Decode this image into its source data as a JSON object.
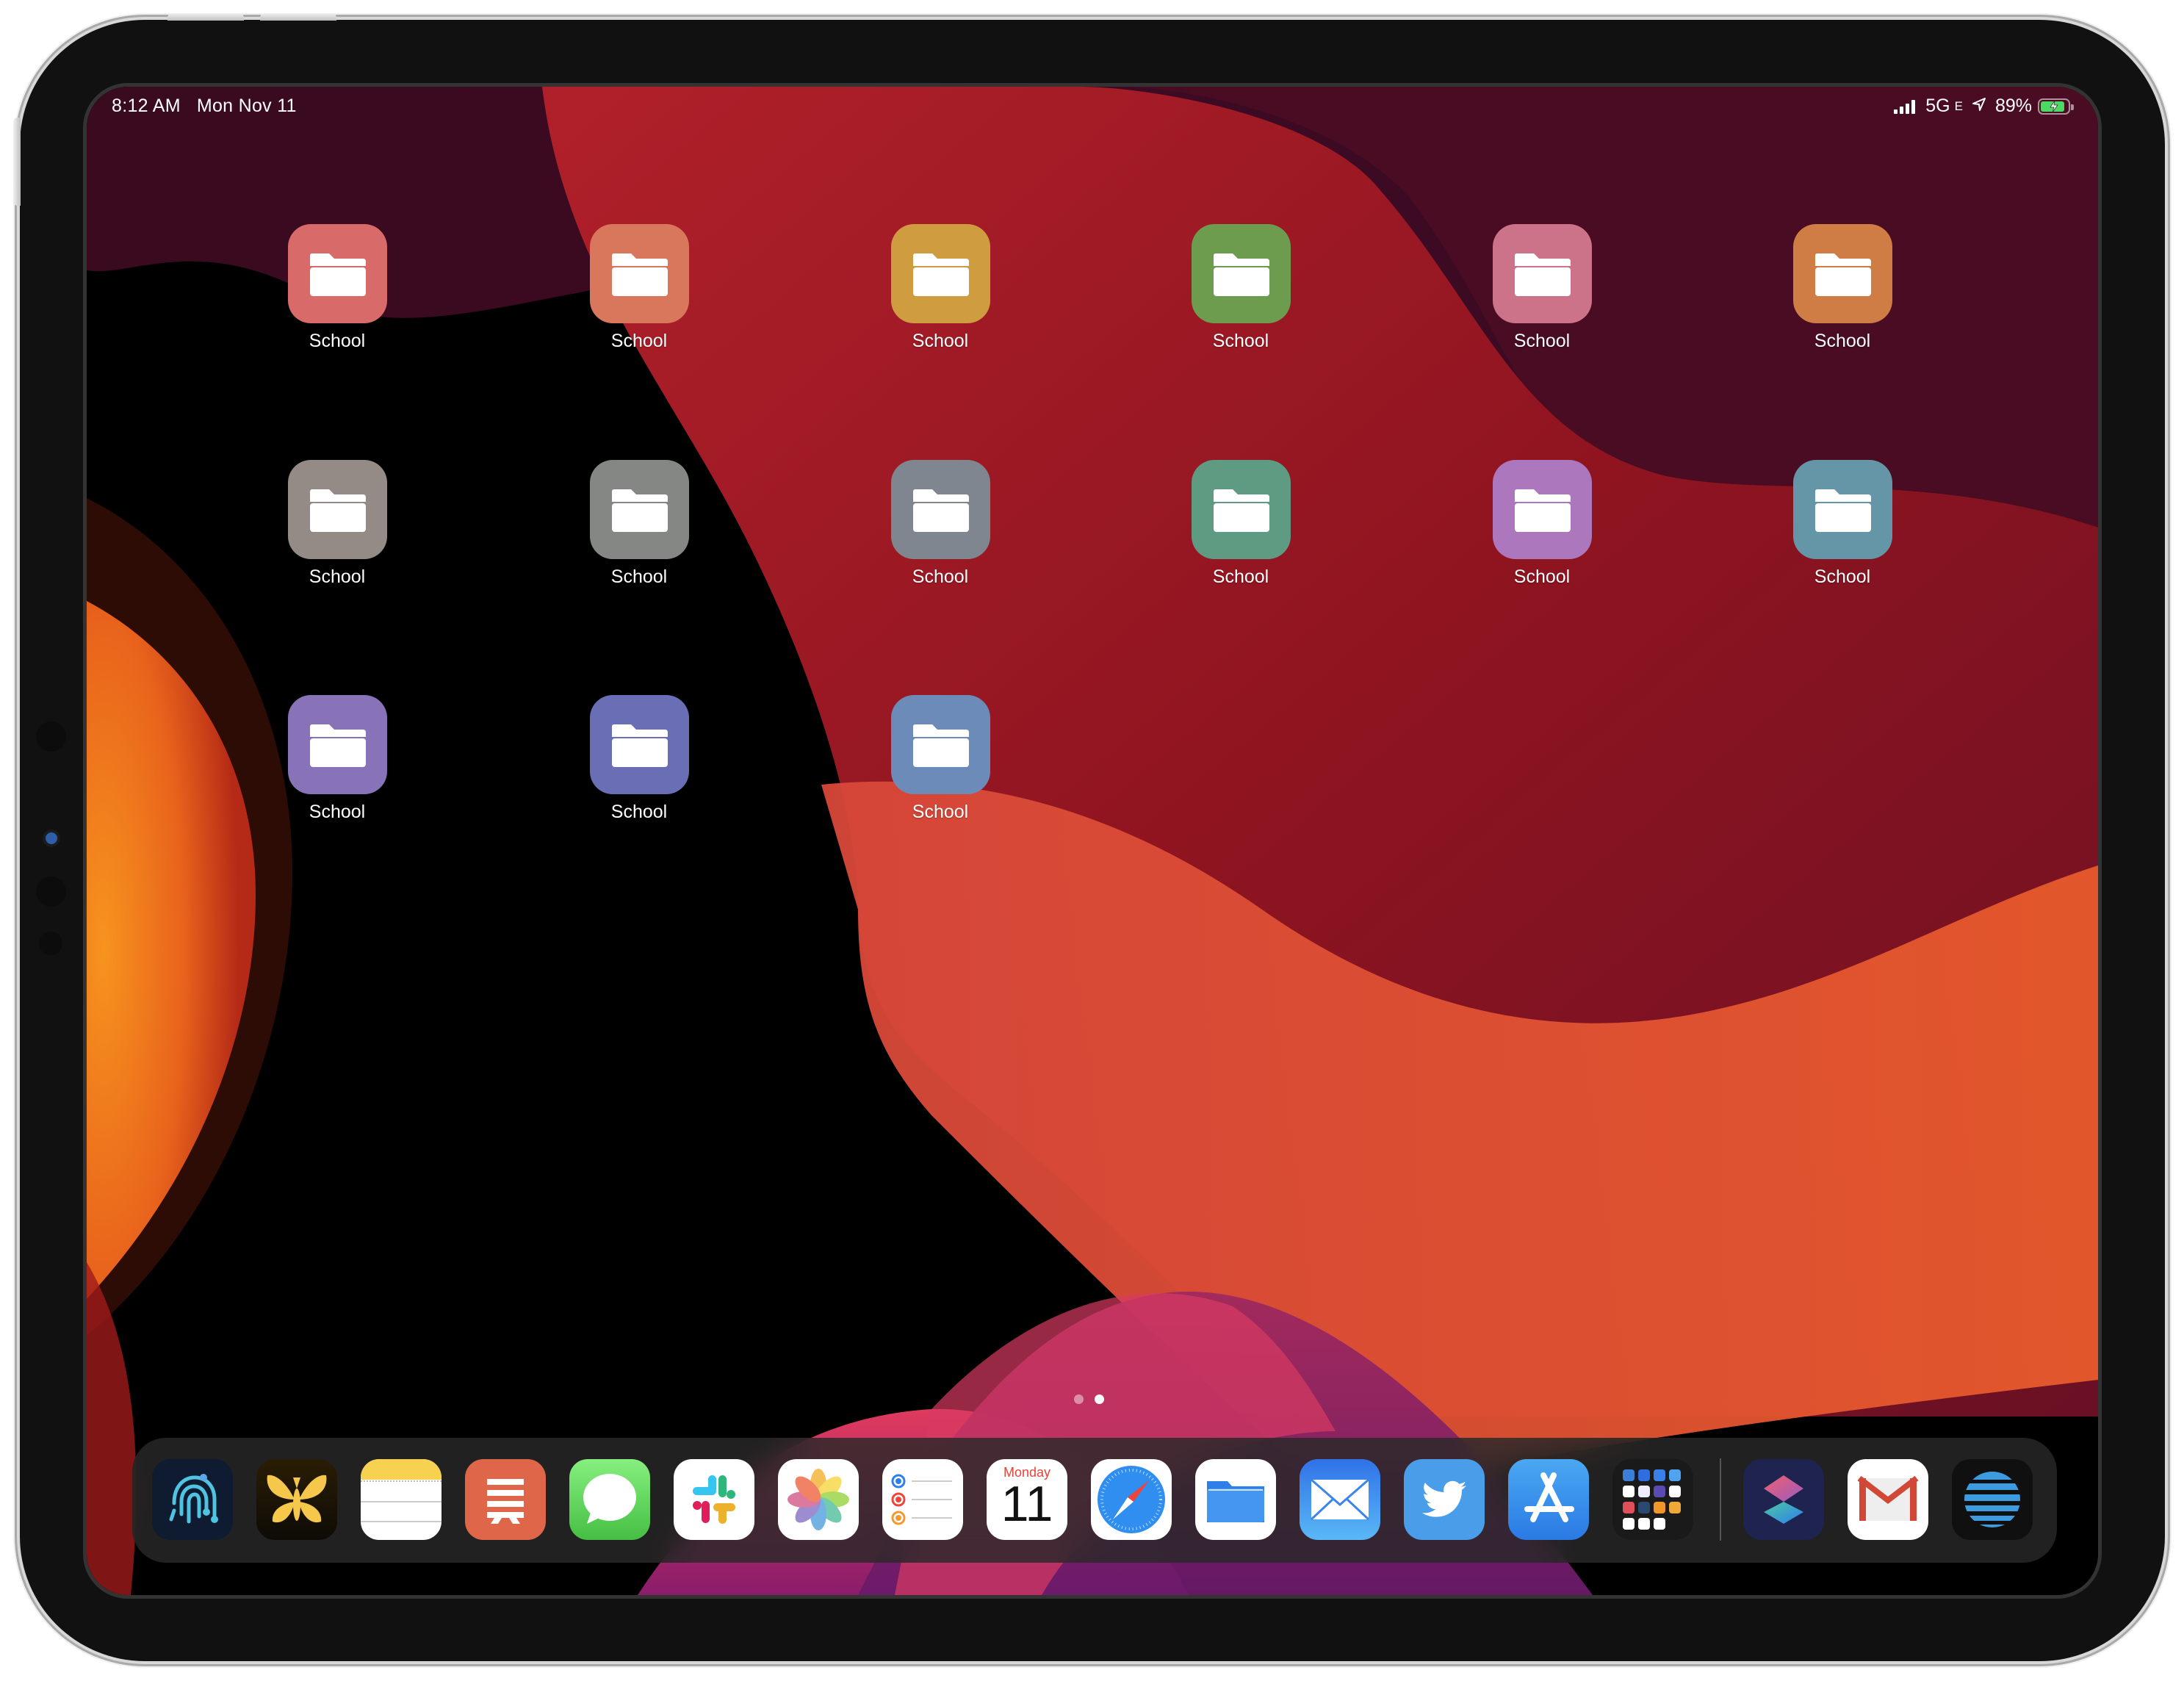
{
  "status_bar": {
    "time": "8:12 AM",
    "date": "Mon Nov 11",
    "network": "5G",
    "network_sub": "E",
    "battery_percent": "89%",
    "battery_level": 0.89,
    "charging": true,
    "icons": [
      "signal-bars-icon",
      "location-arrow-icon",
      "battery-charging-icon"
    ]
  },
  "home_screen": {
    "apps": [
      {
        "label": "School",
        "icon": "folder-icon",
        "color": "#d86a6a"
      },
      {
        "label": "School",
        "icon": "folder-icon",
        "color": "#d9775c"
      },
      {
        "label": "School",
        "icon": "folder-icon",
        "color": "#cf9c40"
      },
      {
        "label": "School",
        "icon": "folder-icon",
        "color": "#6e9c4f"
      },
      {
        "label": "School",
        "icon": "folder-icon",
        "color": "#cd7389"
      },
      {
        "label": "School",
        "icon": "folder-icon",
        "color": "#d07d45"
      },
      {
        "label": "School",
        "icon": "folder-icon",
        "color": "#948a86"
      },
      {
        "label": "School",
        "icon": "folder-icon",
        "color": "#848784"
      },
      {
        "label": "School",
        "icon": "folder-icon",
        "color": "#7f8690"
      },
      {
        "label": "School",
        "icon": "folder-icon",
        "color": "#5f9a82"
      },
      {
        "label": "School",
        "icon": "folder-icon",
        "color": "#ad77bd"
      },
      {
        "label": "School",
        "icon": "folder-icon",
        "color": "#6596a8"
      },
      {
        "label": "School",
        "icon": "folder-icon",
        "color": "#8872b8"
      },
      {
        "label": "School",
        "icon": "folder-icon",
        "color": "#6a6fb5"
      },
      {
        "label": "School",
        "icon": "folder-icon",
        "color": "#6d8bb9"
      }
    ],
    "page_count": 2,
    "current_page": 2
  },
  "dock": {
    "apps": [
      {
        "name": "Fingerprint app",
        "icon": "fingerprint-icon"
      },
      {
        "name": "Ulysses",
        "icon": "butterfly-icon"
      },
      {
        "name": "Notes",
        "icon": "notes-icon"
      },
      {
        "name": "Readdle-style text app",
        "icon": "text-lines-icon"
      },
      {
        "name": "Messages",
        "icon": "messages-icon"
      },
      {
        "name": "Slack",
        "icon": "slack-icon"
      },
      {
        "name": "Photos",
        "icon": "photos-icon"
      },
      {
        "name": "Reminders",
        "icon": "reminders-icon"
      },
      {
        "name": "Calendar",
        "icon": "calendar-icon",
        "day": "Monday",
        "date": "11"
      },
      {
        "name": "Safari",
        "icon": "compass-icon"
      },
      {
        "name": "Files",
        "icon": "files-icon"
      },
      {
        "name": "Mail",
        "icon": "mail-icon"
      },
      {
        "name": "Twitter",
        "icon": "twitter-bird-icon"
      },
      {
        "name": "App Store",
        "icon": "app-store-icon"
      },
      {
        "name": "App Library folder",
        "icon": "app-folder-icon"
      }
    ],
    "recent_apps": [
      {
        "name": "Shortcuts",
        "icon": "shortcuts-icon"
      },
      {
        "name": "Gmail",
        "icon": "gmail-icon"
      },
      {
        "name": "AT&T",
        "icon": "att-globe-icon"
      }
    ]
  }
}
